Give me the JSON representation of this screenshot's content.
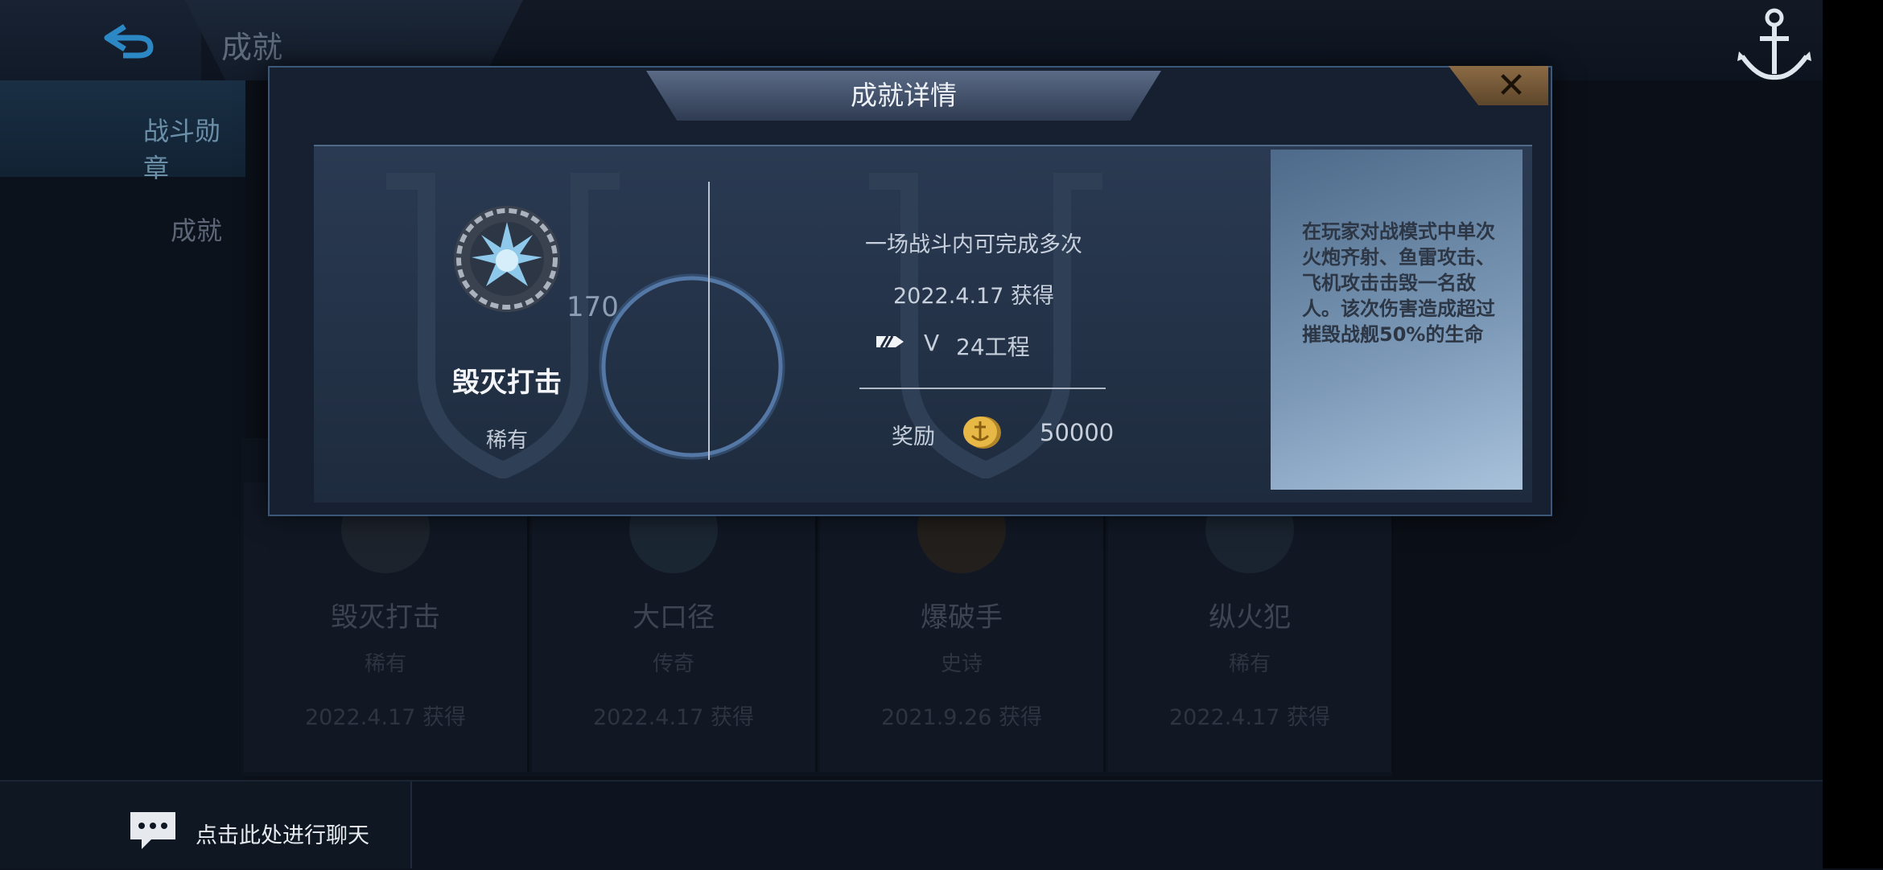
{
  "header": {
    "title": "成就"
  },
  "sidebar": {
    "items": [
      {
        "label": "战斗勋章"
      },
      {
        "label": "成就"
      }
    ]
  },
  "cards": [
    {
      "name": "毁灭打击",
      "rarity": "稀有",
      "date": "2022.4.17 获得"
    },
    {
      "name": "大口径",
      "rarity": "传奇",
      "date": "2022.4.17 获得"
    },
    {
      "name": "爆破手",
      "rarity": "史诗",
      "date": "2021.9.26 获得"
    },
    {
      "name": "纵火犯",
      "rarity": "稀有",
      "date": "2022.4.17 获得"
    }
  ],
  "chat": {
    "label": "点击此处进行聊天"
  },
  "modal": {
    "title": "成就详情",
    "badge_name": "毁灭打击",
    "badge_rarity": "稀有",
    "progress": "170",
    "condition": "一场战斗内可完成多次",
    "date": "2022.4.17 获得",
    "v_symbol": "V",
    "ship": "24工程",
    "reward_label": "奖励",
    "reward_value": "50000",
    "description": "在玩家对战模式中单次火炮齐射、鱼雷攻击、飞机攻击击毁一名敌人。该次伤害造成超过摧毁战舰50%的生命"
  },
  "icons": [
    "back-arrow-icon",
    "anchor-icon",
    "close-icon",
    "chat-icon",
    "gold-coin-icon",
    "ship-type-icon",
    "achievement-badge-icon"
  ],
  "colors": {
    "accent": "#2c88c4",
    "modal_border": "#3c5878",
    "close_bg": "#8c6b45"
  }
}
